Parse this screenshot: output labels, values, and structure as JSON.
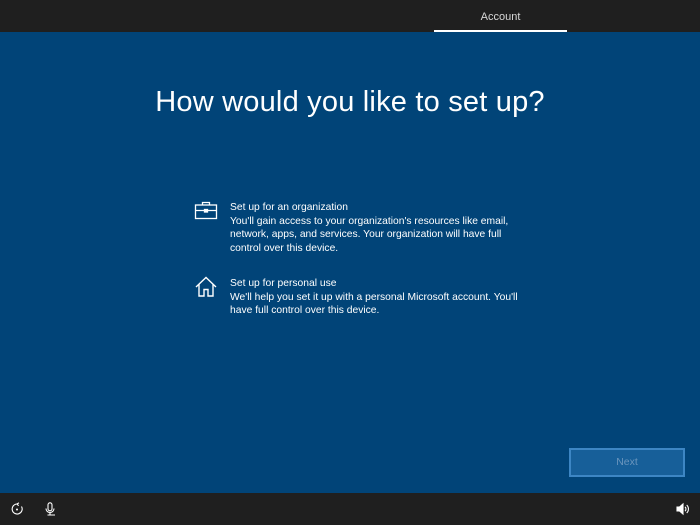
{
  "header": {
    "tabs": [
      {
        "label": "Account",
        "active": true
      }
    ]
  },
  "main": {
    "title": "How would you like to set up?",
    "options": [
      {
        "icon": "briefcase-icon",
        "title": "Set up for an organization",
        "description": "You'll gain access to your organization's resources like email, network, apps, and services. Your organization will have full control over this device."
      },
      {
        "icon": "home-icon",
        "title": "Set up for personal use",
        "description": "We'll help you set it up with a personal Microsoft account. You'll have full control over this device."
      }
    ],
    "next_label": "Next"
  },
  "footer": {
    "left_icons": [
      "ease-of-access-icon",
      "microphone-icon"
    ],
    "right_icons": [
      "volume-icon"
    ]
  },
  "colors": {
    "background": "#014478",
    "bars": "#1f1f1f",
    "button_fill": "#175f99",
    "button_border": "#3d86c4"
  }
}
